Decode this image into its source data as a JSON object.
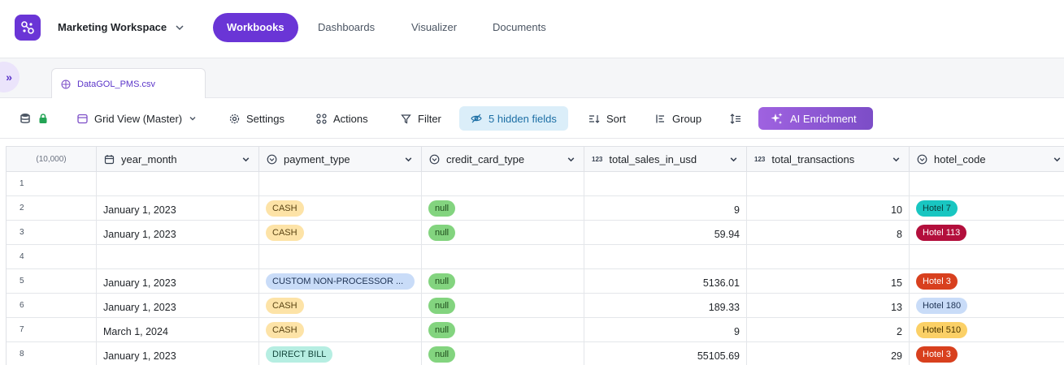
{
  "nav": {
    "workspace": "Marketing Workspace",
    "tabs": [
      "Workbooks",
      "Dashboards",
      "Visualizer",
      "Documents"
    ],
    "active_tab": "Workbooks"
  },
  "sheet": {
    "file_name": "DataGOL_PMS.csv"
  },
  "toolbar": {
    "view": "Grid View (Master)",
    "settings": "Settings",
    "actions": "Actions",
    "filter": "Filter",
    "hidden_fields": "5 hidden fields",
    "sort": "Sort",
    "group": "Group",
    "ai": "AI Enrichment"
  },
  "grid": {
    "row_count": "(10,000)",
    "columns": [
      {
        "name": "year_month",
        "icon": "calendar-icon"
      },
      {
        "name": "payment_type",
        "icon": "single-select-icon"
      },
      {
        "name": "credit_card_type",
        "icon": "single-select-icon"
      },
      {
        "name": "total_sales_in_usd",
        "icon": "number-icon"
      },
      {
        "name": "total_transactions",
        "icon": "number-icon"
      },
      {
        "name": "hotel_code",
        "icon": "single-select-icon"
      }
    ],
    "number_icon_text": "123",
    "rows": [
      {
        "n": "1",
        "year_month": "",
        "payment_type": "",
        "credit_card_type": "",
        "total_sales_in_usd": "",
        "total_transactions": "",
        "hotel_code": ""
      },
      {
        "n": "2",
        "year_month": "January 1, 2023",
        "payment_type": "CASH",
        "credit_card_type": "null",
        "total_sales_in_usd": "9",
        "total_transactions": "10",
        "hotel_code": "Hotel 7"
      },
      {
        "n": "3",
        "year_month": "January 1, 2023",
        "payment_type": "CASH",
        "credit_card_type": "null",
        "total_sales_in_usd": "59.94",
        "total_transactions": "8",
        "hotel_code": "Hotel 113"
      },
      {
        "n": "4",
        "year_month": "",
        "payment_type": "",
        "credit_card_type": "",
        "total_sales_in_usd": "",
        "total_transactions": "",
        "hotel_code": ""
      },
      {
        "n": "5",
        "year_month": "January 1, 2023",
        "payment_type": "CUSTOM NON-PROCESSOR ...",
        "credit_card_type": "null",
        "total_sales_in_usd": "5136.01",
        "total_transactions": "15",
        "hotel_code": "Hotel 3"
      },
      {
        "n": "6",
        "year_month": "January 1, 2023",
        "payment_type": "CASH",
        "credit_card_type": "null",
        "total_sales_in_usd": "189.33",
        "total_transactions": "13",
        "hotel_code": "Hotel 180"
      },
      {
        "n": "7",
        "year_month": "March 1, 2024",
        "payment_type": "CASH",
        "credit_card_type": "null",
        "total_sales_in_usd": "9",
        "total_transactions": "2",
        "hotel_code": "Hotel 510"
      },
      {
        "n": "8",
        "year_month": "January 1, 2023",
        "payment_type": "DIRECT BILL",
        "credit_card_type": "null",
        "total_sales_in_usd": "55105.69",
        "total_transactions": "29",
        "hotel_code": "Hotel 3"
      }
    ]
  },
  "colors": {
    "brand": "#6a35d6",
    "hidden_fields_bg": "#dbeef9",
    "ai_button": "#8f5ad8",
    "cash_pill": "#fde3a7",
    "custom_pill": "#c9dcf8",
    "direct_bill_pill": "#b6eee2",
    "null_pill": "#83d47f",
    "hotel_7": "#19c6c1",
    "hotel_113": "#b30f3c",
    "hotel_3": "#d8401e",
    "hotel_180": "#c9dcf8",
    "hotel_510": "#fbd066"
  }
}
